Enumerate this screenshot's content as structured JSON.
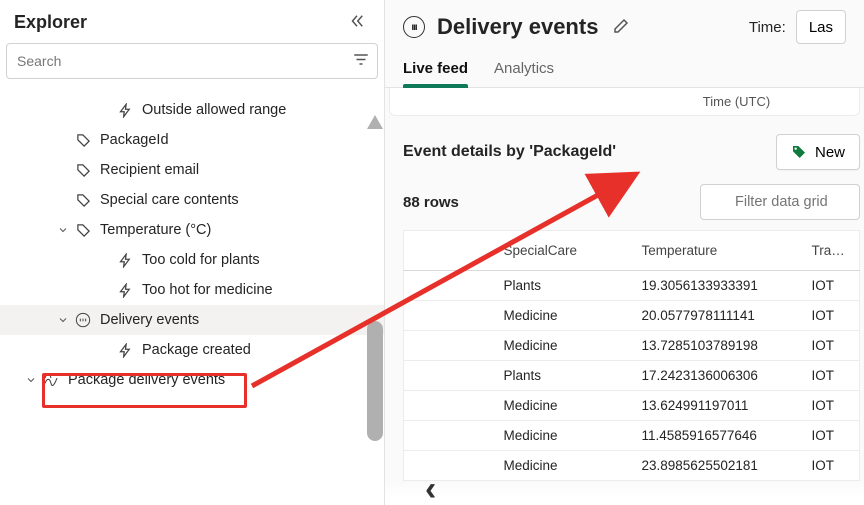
{
  "explorer": {
    "title": "Explorer",
    "search_placeholder": "Search",
    "items": {
      "outside_allowed": "Outside allowed range",
      "package_id": "PackageId",
      "recipient_email": "Recipient email",
      "special_care": "Special care contents",
      "temperature_group": "Temperature (°C)",
      "too_cold": "Too cold for plants",
      "too_hot": "Too hot for medicine",
      "delivery_events": "Delivery events",
      "package_created": "Package created",
      "package_delivery_events": "Package delivery events"
    }
  },
  "header": {
    "page_title": "Delivery events",
    "time_label": "Time:",
    "time_value": "Las"
  },
  "tabs": {
    "live_feed": "Live feed",
    "analytics": "Analytics"
  },
  "utc_label": "Time (UTC)",
  "details": {
    "title": "Event details by 'PackageId'",
    "new_button": "New",
    "row_count": "88 rows",
    "filter_placeholder": "Filter data grid"
  },
  "grid": {
    "columns": {
      "special": "SpecialCare",
      "temp": "Temperature",
      "track": "Tracking"
    },
    "rows": [
      {
        "special": "Plants",
        "temp": "19.3056133933391",
        "track": "IOT"
      },
      {
        "special": "Medicine",
        "temp": "20.0577978111141",
        "track": "IOT"
      },
      {
        "special": "Medicine",
        "temp": "13.7285103789198",
        "track": "IOT"
      },
      {
        "special": "Plants",
        "temp": "17.2423136006306",
        "track": "IOT"
      },
      {
        "special": "Medicine",
        "temp": "13.624991197011",
        "track": "IOT"
      },
      {
        "special": "Medicine",
        "temp": "11.4585916577646",
        "track": "IOT"
      },
      {
        "special": "Medicine",
        "temp": "23.8985625502181",
        "track": "IOT"
      }
    ]
  }
}
